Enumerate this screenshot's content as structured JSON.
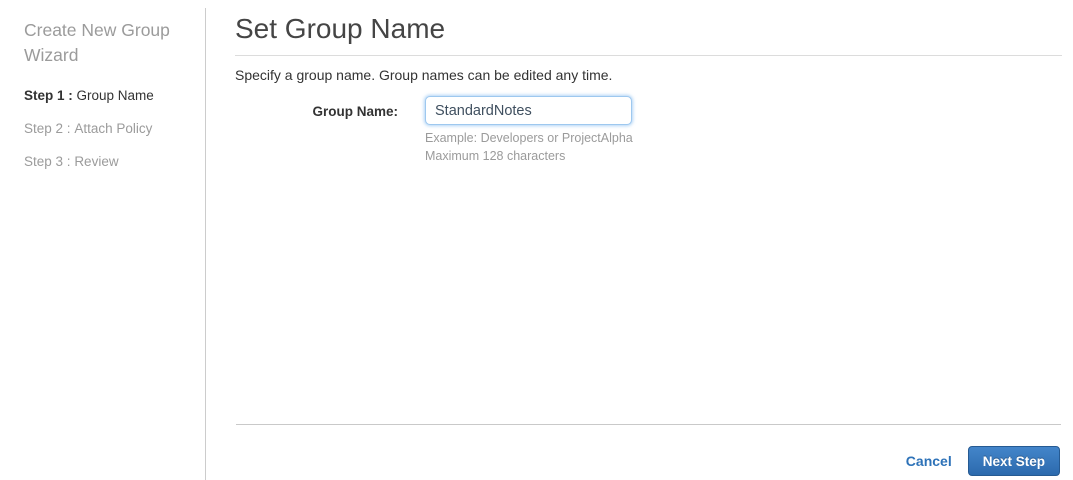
{
  "sidebar": {
    "title": "Create New Group Wizard",
    "steps": [
      {
        "prefix": "Step 1 :",
        "label": "Group Name",
        "active": true
      },
      {
        "prefix": "Step 2 :",
        "label": "Attach Policy",
        "active": false
      },
      {
        "prefix": "Step 3 :",
        "label": "Review",
        "active": false
      }
    ]
  },
  "main": {
    "title": "Set Group Name",
    "description": "Specify a group name. Group names can be edited any time.",
    "form": {
      "group_name_label": "Group Name:",
      "group_name_value": "StandardNotes",
      "hint_example": "Example: Developers or ProjectAlpha",
      "hint_max": "Maximum 128 characters"
    }
  },
  "footer": {
    "cancel_label": "Cancel",
    "next_label": "Next Step"
  },
  "colors": {
    "accent_blue": "#2d72b8",
    "button_gradient_top": "#4385ca",
    "button_gradient_bottom": "#2c6aad",
    "muted_text": "#9b9b9b",
    "input_focus_border": "#9ec8ef"
  }
}
